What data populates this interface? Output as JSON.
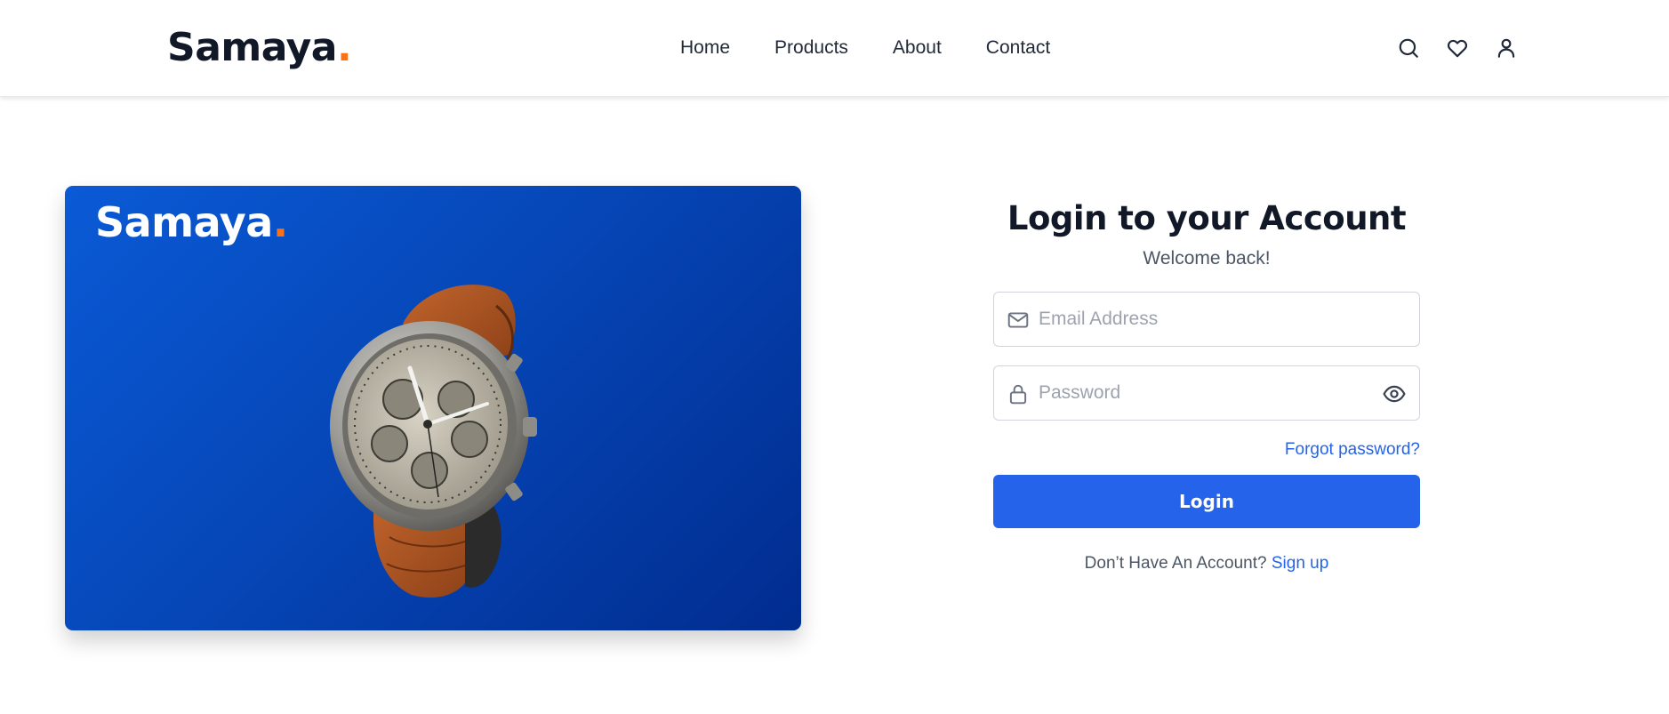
{
  "header": {
    "logo": {
      "text": "Samaya",
      "dot": "."
    },
    "nav": [
      {
        "label": "Home"
      },
      {
        "label": "Products"
      },
      {
        "label": "About"
      },
      {
        "label": "Contact"
      }
    ],
    "icons": [
      "search-icon",
      "heart-icon",
      "user-icon"
    ]
  },
  "hero": {
    "logo": {
      "text": "Samaya",
      "dot": "."
    },
    "image": "wristwatch"
  },
  "login": {
    "title": "Login to your Account",
    "subtitle": "Welcome back!",
    "email": {
      "value": "",
      "placeholder": "Email Address",
      "icon": "mail-icon"
    },
    "password": {
      "value": "",
      "placeholder": "Password",
      "icon": "lock-icon",
      "toggle_icon": "eye-icon"
    },
    "forgot_label": "Forgot password?",
    "submit_label": "Login",
    "signup_prompt": "Don’t Have An Account?",
    "signup_label": "Sign up"
  },
  "colors": {
    "accent": "#2563eb",
    "logo_dot": "#f97316",
    "hero_gradient_start": "#0a5ad6",
    "hero_gradient_end": "#012c8f"
  }
}
